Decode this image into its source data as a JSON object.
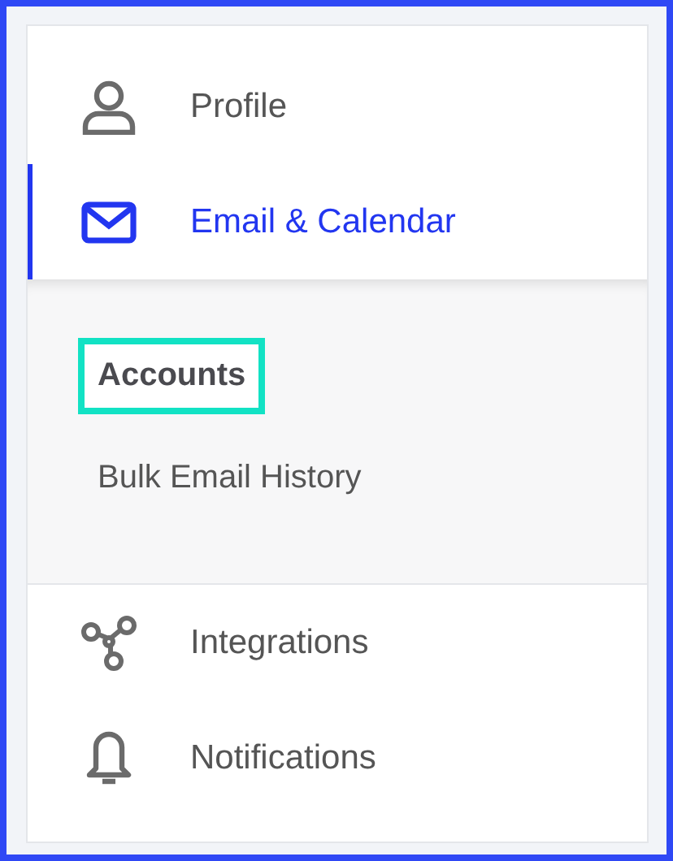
{
  "menu": {
    "items": [
      {
        "label": "Profile",
        "selected": false
      },
      {
        "label": "Email & Calendar",
        "selected": true,
        "children": [
          {
            "label": "Accounts",
            "selected": true
          },
          {
            "label": "Bulk Email History",
            "selected": false
          }
        ]
      },
      {
        "label": "Integrations",
        "selected": false
      },
      {
        "label": "Notifications",
        "selected": false
      }
    ]
  }
}
